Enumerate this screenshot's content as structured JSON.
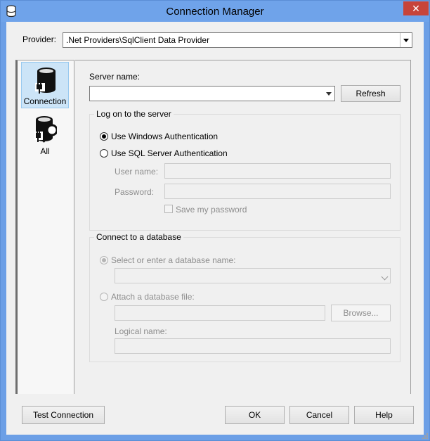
{
  "window": {
    "title": "Connection Manager",
    "close_glyph": "✕"
  },
  "provider": {
    "label": "Provider:",
    "value": ".Net Providers\\SqlClient Data Provider"
  },
  "nav": {
    "items": [
      {
        "label": "Connection",
        "icon": "database-plug-icon",
        "selected": true
      },
      {
        "label": "All",
        "icon": "database-wrench-icon",
        "selected": false
      }
    ]
  },
  "server": {
    "label": "Server name:",
    "value": "",
    "refresh_label": "Refresh"
  },
  "logon": {
    "title": "Log on to the server",
    "windows_auth": "Use Windows Authentication",
    "sql_auth": "Use SQL Server Authentication",
    "selected": "windows",
    "user_label": "User name:",
    "password_label": "Password:",
    "save_password": "Save my password"
  },
  "database": {
    "title": "Connect to a database",
    "select_label": "Select or enter a database name:",
    "attach_label": "Attach a database file:",
    "browse_label": "Browse...",
    "logical_label": "Logical name:"
  },
  "footer": {
    "test_label": "Test Connection",
    "ok_label": "OK",
    "cancel_label": "Cancel",
    "help_label": "Help"
  },
  "colors": {
    "titlebar": "#6fa3ea",
    "close": "#c7443a",
    "selected_nav": "#cce4f7"
  }
}
